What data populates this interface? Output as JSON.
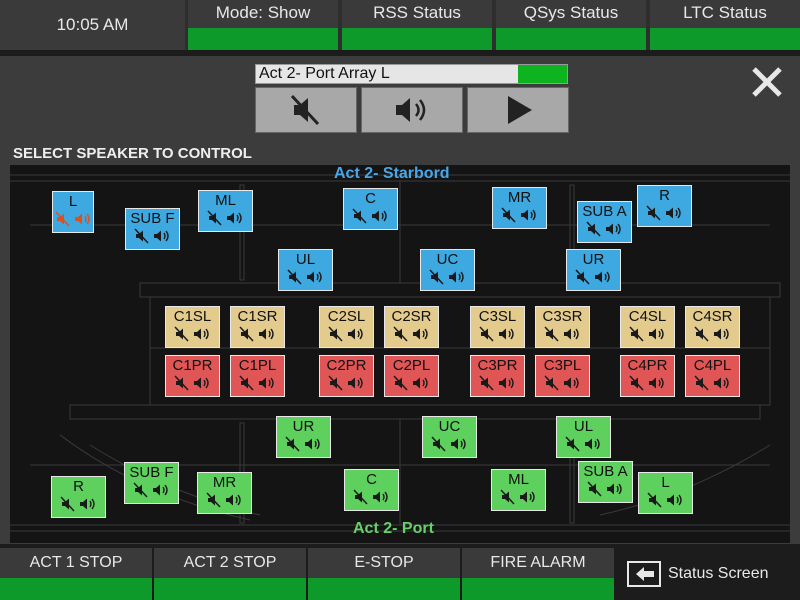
{
  "header": {
    "clock": "10:05 AM",
    "tabs": [
      {
        "label": "Mode: Show",
        "indicator": "#0d9a2a"
      },
      {
        "label": "RSS Status",
        "indicator": "#0d9a2a"
      },
      {
        "label": "QSys Status",
        "indicator": "#0d9a2a"
      },
      {
        "label": "LTC Status",
        "indicator": "#0d9a2a"
      }
    ]
  },
  "selection": {
    "name": "Act 2- Port Array L",
    "level_indicator": "#0db41f",
    "controls": [
      "mute-icon",
      "volume-icon",
      "play-icon"
    ],
    "close_icon": "close-icon"
  },
  "speakers_title": "SELECT SPEAKER TO CONTROL",
  "stage": {
    "starbord_label": "Act 2- Starbord",
    "port_label": "Act 2- Port"
  },
  "speakers": [
    {
      "label": "L",
      "color": "blue",
      "active": true
    },
    {
      "label": "SUB F",
      "color": "blue"
    },
    {
      "label": "ML",
      "color": "blue"
    },
    {
      "label": "C",
      "color": "blue"
    },
    {
      "label": "MR",
      "color": "blue"
    },
    {
      "label": "SUB A",
      "color": "blue"
    },
    {
      "label": "R",
      "color": "blue"
    },
    {
      "label": "UL",
      "color": "blue"
    },
    {
      "label": "UC",
      "color": "blue"
    },
    {
      "label": "UR",
      "color": "blue"
    },
    {
      "label": "C1SL",
      "color": "tan"
    },
    {
      "label": "C1SR",
      "color": "tan"
    },
    {
      "label": "C2SL",
      "color": "tan"
    },
    {
      "label": "C2SR",
      "color": "tan"
    },
    {
      "label": "C3SL",
      "color": "tan"
    },
    {
      "label": "C3SR",
      "color": "tan"
    },
    {
      "label": "C4SL",
      "color": "tan"
    },
    {
      "label": "C4SR",
      "color": "tan"
    },
    {
      "label": "C1PR",
      "color": "red"
    },
    {
      "label": "C1PL",
      "color": "red"
    },
    {
      "label": "C2PR",
      "color": "red"
    },
    {
      "label": "C2PL",
      "color": "red"
    },
    {
      "label": "C3PR",
      "color": "red"
    },
    {
      "label": "C3PL",
      "color": "red"
    },
    {
      "label": "C4PR",
      "color": "red"
    },
    {
      "label": "C4PL",
      "color": "red"
    },
    {
      "label": "UR",
      "color": "green"
    },
    {
      "label": "UC",
      "color": "green"
    },
    {
      "label": "UL",
      "color": "green"
    },
    {
      "label": "R",
      "color": "green"
    },
    {
      "label": "SUB F",
      "color": "green"
    },
    {
      "label": "MR",
      "color": "green"
    },
    {
      "label": "C",
      "color": "green"
    },
    {
      "label": "ML",
      "color": "green"
    },
    {
      "label": "SUB A",
      "color": "green"
    },
    {
      "label": "L",
      "color": "green"
    }
  ],
  "footer": {
    "buttons": [
      {
        "label": "ACT 1 STOP",
        "indicator": "#0d9a2a"
      },
      {
        "label": "ACT 2 STOP",
        "indicator": "#0d9a2a"
      },
      {
        "label": "E-STOP",
        "indicator": "#0d9a2a"
      },
      {
        "label": "FIRE ALARM",
        "indicator": "#0d9a2a"
      }
    ],
    "status_screen": "Status Screen",
    "status_screen_icon": "return-icon"
  }
}
